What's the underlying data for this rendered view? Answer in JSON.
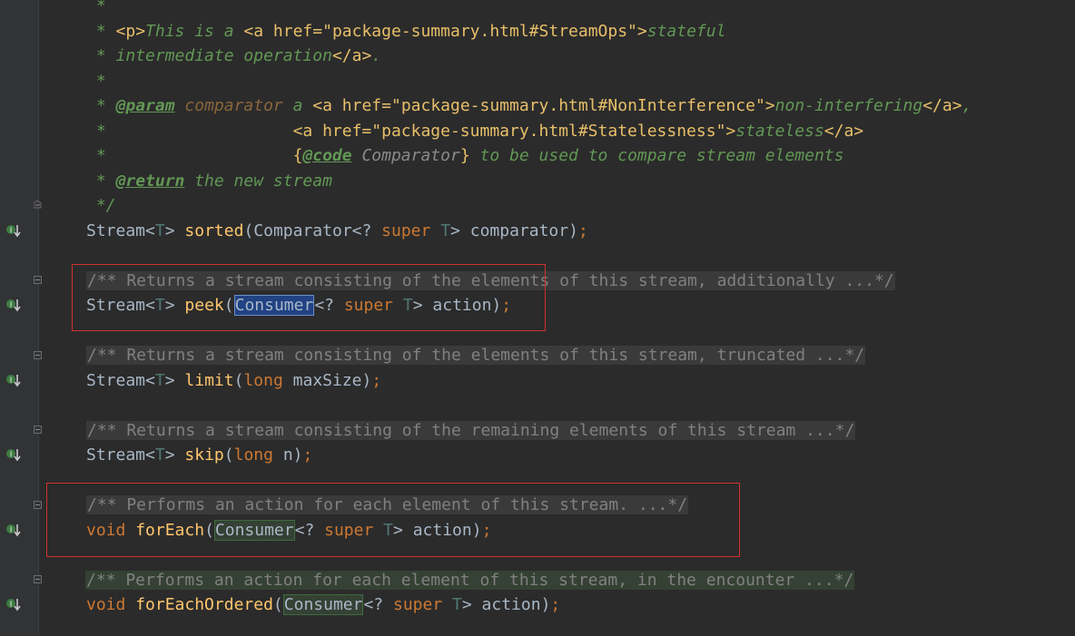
{
  "colors": {
    "background": "#2b2b2b",
    "doc_comment": "#629755",
    "keyword": "#cc7832",
    "method": "#ffc66d",
    "highlight_box": "#d03030"
  },
  "doc_lines": [
    " *",
    " * <p>This is a <a href=\"package-summary.html#StreamOps\">stateful",
    " * intermediate operation</a>.",
    " *",
    " * @param comparator a <a href=\"package-summary.html#NonInterference\">non-interfering</a>,",
    " *                   <a href=\"package-summary.html#Statelessness\">stateless</a>",
    " *                   {@code Comparator} to be used to compare stream elements",
    " * @return the new stream",
    " */"
  ],
  "code": {
    "sorted": {
      "ret": "Stream",
      "lt": "<",
      "T": "T",
      "gt": ">",
      "name": "sorted",
      "op": "(",
      "ptype": "Comparator",
      "w1": "<? ",
      "super": "super",
      "sp": " ",
      "T2": "T",
      "w2": "> ",
      "param": "comparator",
      "cp": ")",
      "sc": ";"
    },
    "peek_doc": "/** Returns a stream consisting of the elements of this stream, additionally ...*/",
    "peek": {
      "ret": "Stream",
      "lt": "<",
      "T": "T",
      "gt": ">",
      "name": "peek",
      "op": "(",
      "ptype": "Consumer",
      "w1": "<? ",
      "super": "super",
      "sp": " ",
      "T2": "T",
      "w2": "> ",
      "param": "action",
      "cp": ")",
      "sc": ";"
    },
    "limit_doc": "/** Returns a stream consisting of the elements of this stream, truncated ...*/",
    "limit": {
      "ret": "Stream",
      "lt": "<",
      "T": "T",
      "gt": ">",
      "name": "limit",
      "op": "(",
      "ptype": "long",
      "sp": " ",
      "param": "maxSize",
      "cp": ")",
      "sc": ";"
    },
    "skip_doc": "/** Returns a stream consisting of the remaining elements of this stream ...*/",
    "skip": {
      "ret": "Stream",
      "lt": "<",
      "T": "T",
      "gt": ">",
      "name": "skip",
      "op": "(",
      "ptype": "long",
      "sp": " ",
      "param": "n",
      "cp": ")",
      "sc": ";"
    },
    "forEach_doc": "/** Performs an action for each element of this stream. ...*/",
    "forEach": {
      "ret": "void",
      "sp0": " ",
      "name": "forEach",
      "op": "(",
      "ptype": "Consumer",
      "w1": "<? ",
      "super": "super",
      "sp": " ",
      "T2": "T",
      "w2": "> ",
      "param": "action",
      "cp": ")",
      "sc": ";"
    },
    "forEachOrdered_doc": "/** Performs an action for each element of this stream, in the encounter ...*/",
    "forEachOrdered": {
      "ret": "void",
      "sp0": " ",
      "name": "forEachOrdered",
      "op": "(",
      "ptype": "Consumer",
      "w1": "<? ",
      "super": "super",
      "sp": " ",
      "T2": "T",
      "w2": "> ",
      "param": "action",
      "cp": ")",
      "sc": ";"
    }
  }
}
